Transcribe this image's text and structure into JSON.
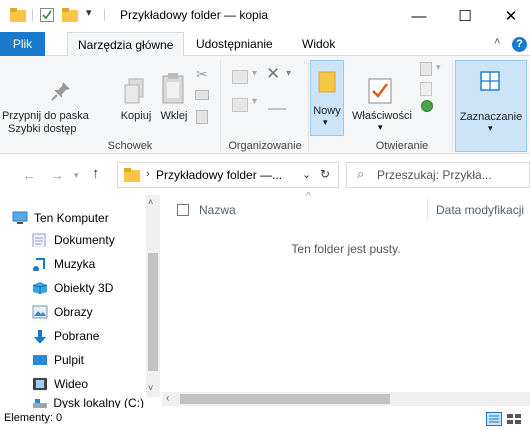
{
  "window": {
    "title": "Przykładowy folder — kopia",
    "minimize": "—",
    "maximize": "☐",
    "close": "✕"
  },
  "ribbon_tabs": [
    "Plik",
    "Narzędzia główne",
    "Udostępnianie",
    "Widok"
  ],
  "ribbon": {
    "pin_label_1": "Przypnij do paska",
    "pin_label_2": "Szybki dostęp",
    "copy_label": "Kopiuj",
    "paste_label": "Wklej",
    "new_label": "Nowy",
    "properties_label": "Właściwości",
    "select_label": "Zaznaczanie",
    "groups": {
      "clipboard": "Schowek",
      "organize": "Organizowanie",
      "open": "Otwieranie"
    }
  },
  "address": {
    "path": "Przykładowy folder —...",
    "search_placeholder": "Przeszukaj: Przykła..."
  },
  "nav_pane": {
    "items": [
      {
        "label": "Ten Komputer",
        "icon": "computer-icon"
      },
      {
        "label": "Dokumenty",
        "icon": "documents-icon"
      },
      {
        "label": "Muzyka",
        "icon": "music-icon"
      },
      {
        "label": "Obiekty 3D",
        "icon": "objects3d-icon"
      },
      {
        "label": "Obrazy",
        "icon": "pictures-icon"
      },
      {
        "label": "Pobrane",
        "icon": "downloads-icon"
      },
      {
        "label": "Pulpit",
        "icon": "desktop-icon"
      },
      {
        "label": "Wideo",
        "icon": "videos-icon"
      },
      {
        "label": "Dysk lokalny (C:)",
        "icon": "drive-icon"
      }
    ]
  },
  "content": {
    "col_name": "Nazwa",
    "col_date": "Data modyfikacji",
    "empty_text": "Ten folder jest pusty."
  },
  "status": {
    "items": "Elementy: 0"
  },
  "colors": {
    "accent": "#1979ca",
    "folder": "#f8c647",
    "nav_blue": "#0078d7"
  }
}
